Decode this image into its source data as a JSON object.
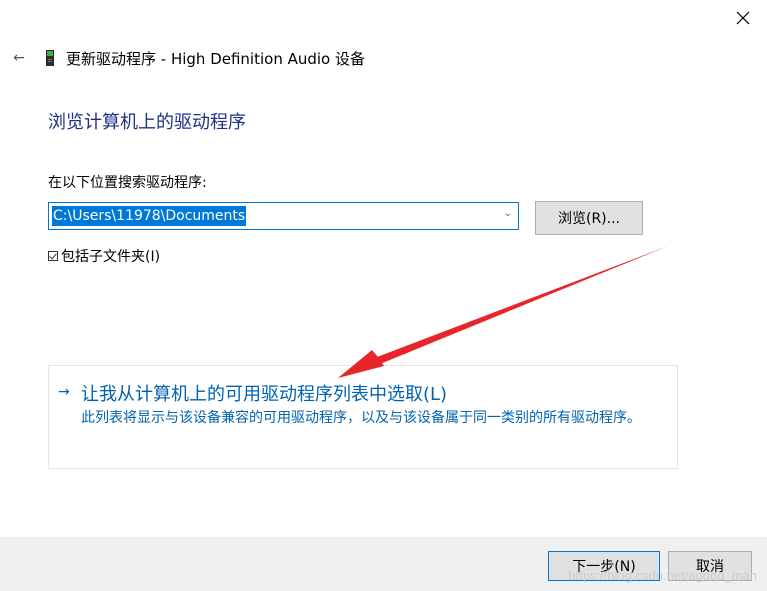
{
  "window": {
    "close_glyph": "✕"
  },
  "header": {
    "back_glyph": "←",
    "title": "更新驱动程序 - High Definition Audio 设备"
  },
  "main": {
    "heading": "浏览计算机上的驱动程序",
    "search_label": "在以下位置搜索驱动程序:",
    "path_value": "C:\\Users\\11978\\Documents",
    "combo_arrow": "⌄",
    "browse_label": "浏览(R)...",
    "include_subfolders_label": "包括子文件夹(I)",
    "include_subfolders_checked": true
  },
  "pick_option": {
    "arrow": "→",
    "title": "让我从计算机上的可用驱动程序列表中选取(L)",
    "description": "此列表将显示与该设备兼容的可用驱动程序，以及与该设备属于同一类别的所有驱动程序。"
  },
  "footer": {
    "next_label": "下一步(N)",
    "cancel_label": "取消"
  },
  "watermark": "https://blog.csdn.net/agood_man",
  "colors": {
    "heading": "#1e3287",
    "link": "#0063b1",
    "selection": "#0078d7",
    "annotation_arrow": "#e8262a",
    "footer_bg": "#f0f0f0"
  },
  "icons": {
    "close": "close-icon",
    "back": "back-arrow-icon",
    "device": "audio-device-icon",
    "dropdown": "chevron-down-icon"
  }
}
